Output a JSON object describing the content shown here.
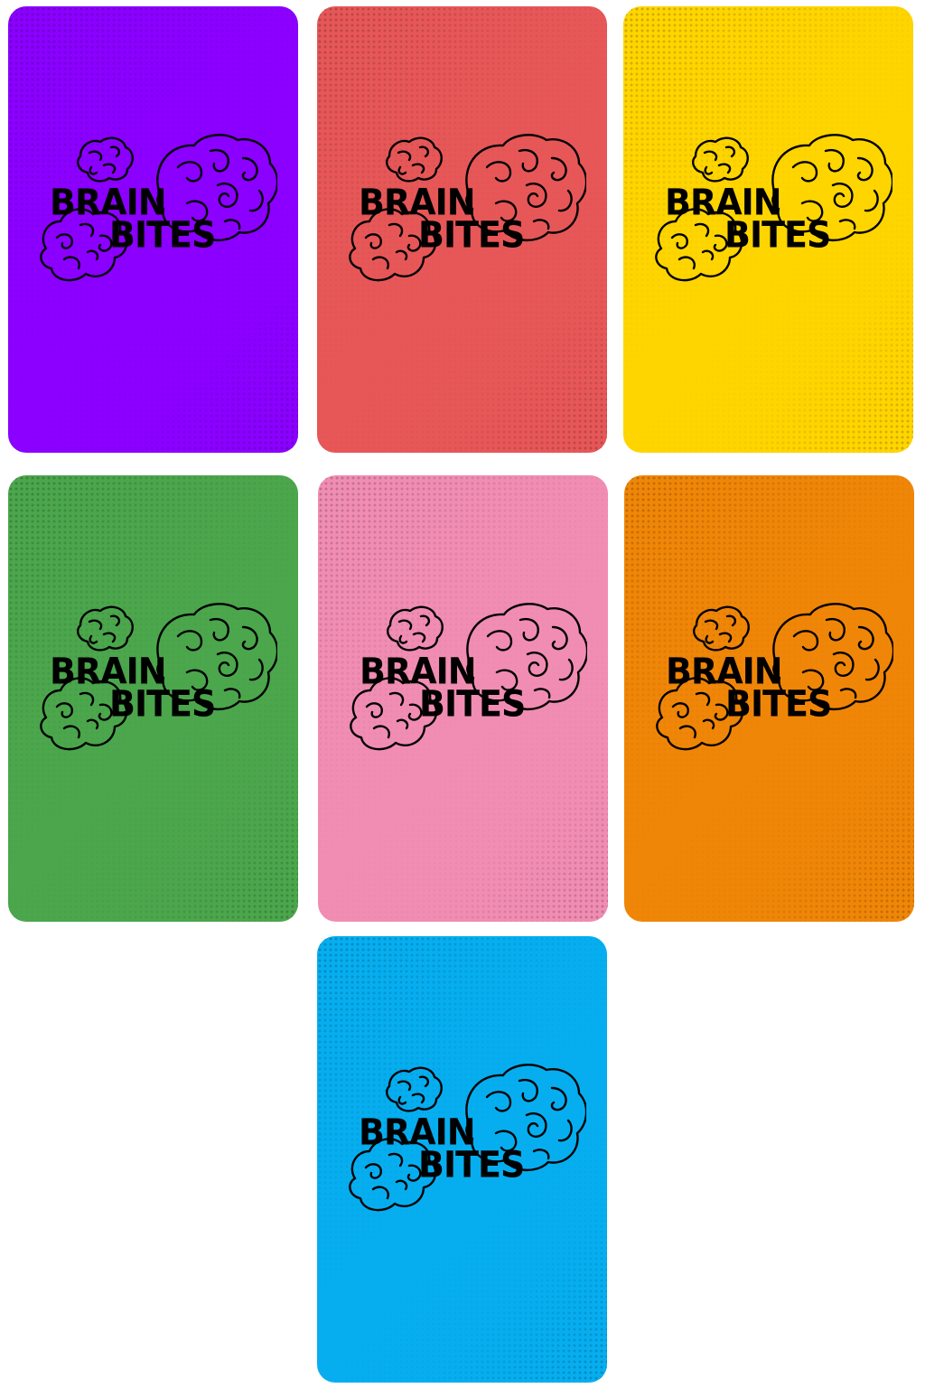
{
  "logo": {
    "line1": "BRAIN",
    "line2": "BITES"
  },
  "cards": [
    {
      "color": "#8b00ff"
    },
    {
      "color": "#e75758"
    },
    {
      "color": "#ffd500"
    },
    {
      "color": "#4ba64c"
    },
    {
      "color": "#f18db2"
    },
    {
      "color": "#f08607"
    },
    {
      "color": "#06aef0"
    }
  ]
}
